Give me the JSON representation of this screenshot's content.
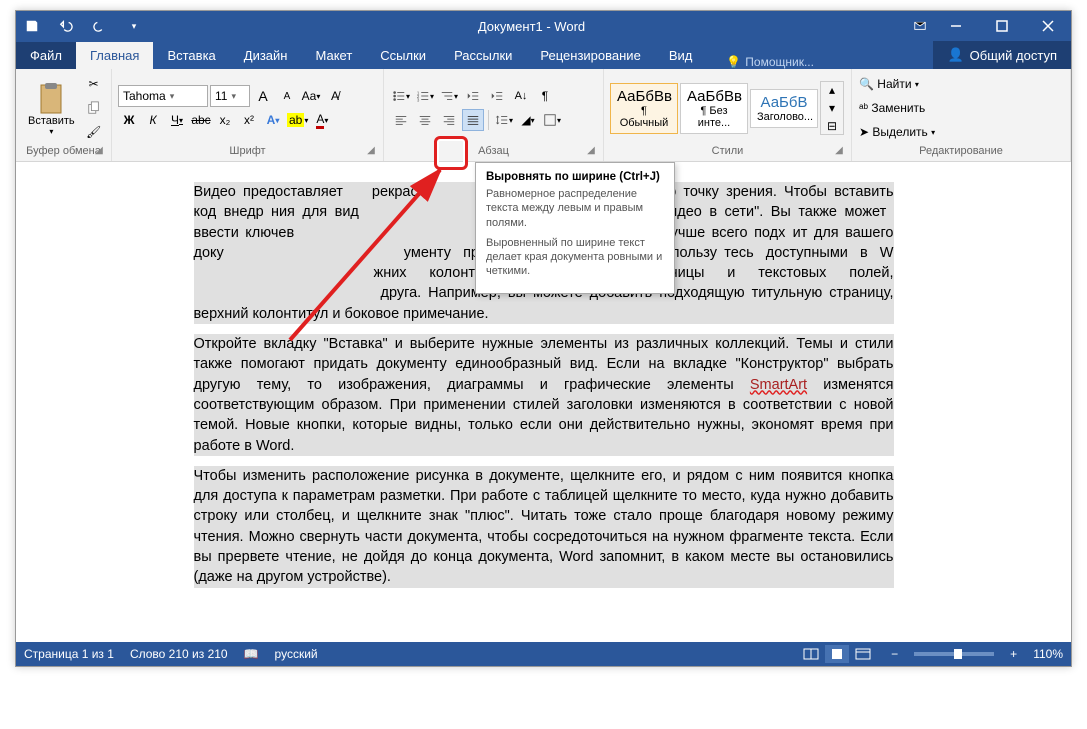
{
  "title": "Документ1 - Word",
  "tabs": {
    "file": "Файл",
    "home": "Главная",
    "insert": "Вставка",
    "design": "Дизайн",
    "layout": "Макет",
    "references": "Ссылки",
    "mailings": "Рассылки",
    "review": "Рецензирование",
    "view": "Вид"
  },
  "tell_me": "Помощник...",
  "share": "Общий доступ",
  "ribbon": {
    "clipboard": {
      "title": "Буфер обмена",
      "paste": "Вставить"
    },
    "font": {
      "title": "Шрифт",
      "name": "Tahoma",
      "size": "11",
      "bold": "Ж",
      "italic": "К",
      "underline": "Ч",
      "strike": "abc",
      "sub": "x₂",
      "sup": "x²",
      "effects": "A",
      "highlight": "ab",
      "color": "A",
      "inc": "A",
      "dec": "A",
      "case": "Aa",
      "clear": "♪"
    },
    "paragraph": {
      "title": "Абзац"
    },
    "styles": {
      "title": "Стили",
      "normal_prev": "АаБбВв",
      "normal": "¶ Обычный",
      "nospacing_prev": "АаБбВв",
      "nospacing": "¶ Без инте...",
      "heading1_prev": "АаБбВ",
      "heading1": "Заголово..."
    },
    "editing": {
      "title": "Редактирование",
      "find": "Найти",
      "replace": "Заменить",
      "select": "Выделить"
    }
  },
  "tooltip": {
    "title": "Выровнять по ширине (Ctrl+J)",
    "p1": "Равномерное распределение текста между левым и правым полями.",
    "p2": "Выровненный по ширине текст делает края документа ровными и четкими."
  },
  "doc": {
    "p1a": "Видео предоставляет ",
    "p1b": "рекрасну",
    "p1c": "ить свою точку зрения. Чтобы вставить код внедр",
    "p1d": "ния для вид",
    "p1e": "авить, нажмите \"Видео в сети\". Вы также может",
    "p1f": " ввести ключев",
    "p1g": "Интернете видео, которое лучше всего подх",
    "p1h": "ит для вашего доку",
    "p1i": "ументу профессиональный вид, воспользу",
    "p1j": "тесь доступными в W",
    "p1k": "жних колонтитулов, титульной страницы и текстовых полей, ",
    "p1l": " друга. Например, вы можете добавить подходящую титульную страницу, верхний колонтитул и боковое примечание.",
    "p2a": "Откройте вкладку \"Вставка\" и выберите нужные элементы из различных коллекций. Темы и стили также помогают придать документу единообразный вид. Если на вкладке \"Конструктор\" выбрать другую тему, то изображения, диаграммы и графические элементы ",
    "p2b": "SmartArt",
    "p2c": " изменятся соответствующим образом. При применении стилей заголовки изменяются в соответствии с новой темой. Новые кнопки, которые видны, только если они действительно нужны, экономят время при работе в Word.",
    "p3": "Чтобы изменить расположение рисунка в документе, щелкните его, и рядом с ним появится кнопка для доступа к параметрам разметки. При работе с таблицей щелкните то место, куда нужно добавить строку или столбец, и щелкните знак \"плюс\". Читать тоже стало проще благодаря новому режиму чтения. Можно свернуть части документа, чтобы сосредоточиться на нужном фрагменте текста. Если вы прервете чтение, не дойдя до конца документа, Word запомнит, в каком месте вы остановились (даже на другом устройстве)."
  },
  "status": {
    "page": "Страница 1 из 1",
    "words": "Слово 210 из 210",
    "lang": "русский",
    "zoom": "110%"
  }
}
